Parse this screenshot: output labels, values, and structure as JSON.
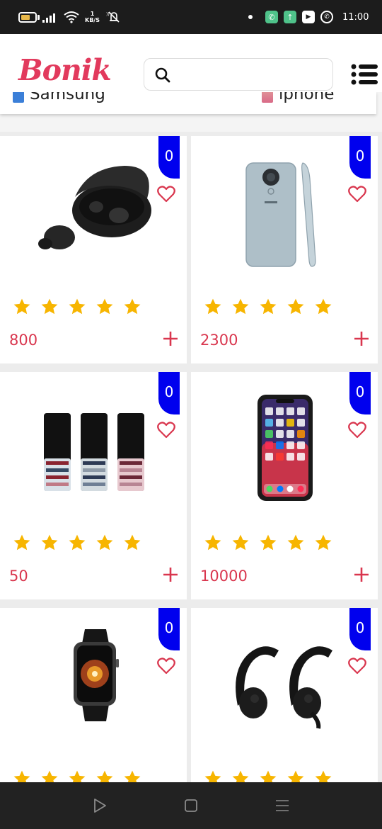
{
  "status_bar": {
    "battery": "65",
    "net_speed_top": "1",
    "net_speed_unit": "KB/S",
    "time": "11:00",
    "icons": [
      "battery-icon",
      "signal-icon",
      "wifi-icon",
      "mute-icon",
      "notification-dot",
      "phone-app-icon",
      "upload-app-icon",
      "youtube-icon",
      "whatsapp-icon"
    ]
  },
  "header": {
    "logo": "Bonik",
    "search": {
      "placeholder": "",
      "value": ""
    },
    "menu_icon": "list-menu-icon"
  },
  "categories": [
    {
      "label": "Samsung",
      "icon": "samsung-category-icon"
    },
    {
      "label": "iphone",
      "icon": "iphone-category-icon"
    }
  ],
  "products": [
    {
      "cart_count": "0",
      "price": "800",
      "image": "wireless-earbuds-image",
      "rating": 5
    },
    {
      "cart_count": "0",
      "price": "2300",
      "image": "nokia-phone-image",
      "rating": 5
    },
    {
      "cart_count": "0",
      "price": "50",
      "image": "keypad-phones-image",
      "rating": 5
    },
    {
      "cart_count": "0",
      "price": "10000",
      "image": "iphone-image",
      "rating": 5
    },
    {
      "cart_count": "0",
      "price": "",
      "image": "smartwatch-image",
      "rating": 5
    },
    {
      "cart_count": "0",
      "price": "",
      "image": "powerbeats-earphones-image",
      "rating": 5
    }
  ],
  "colors": {
    "brand": "#e23a5d",
    "price": "#d9364e",
    "badge": "#0000ee",
    "star": "#f7b500"
  },
  "nav_bar": {
    "icons": [
      "back-icon",
      "home-icon",
      "recents-icon"
    ]
  }
}
